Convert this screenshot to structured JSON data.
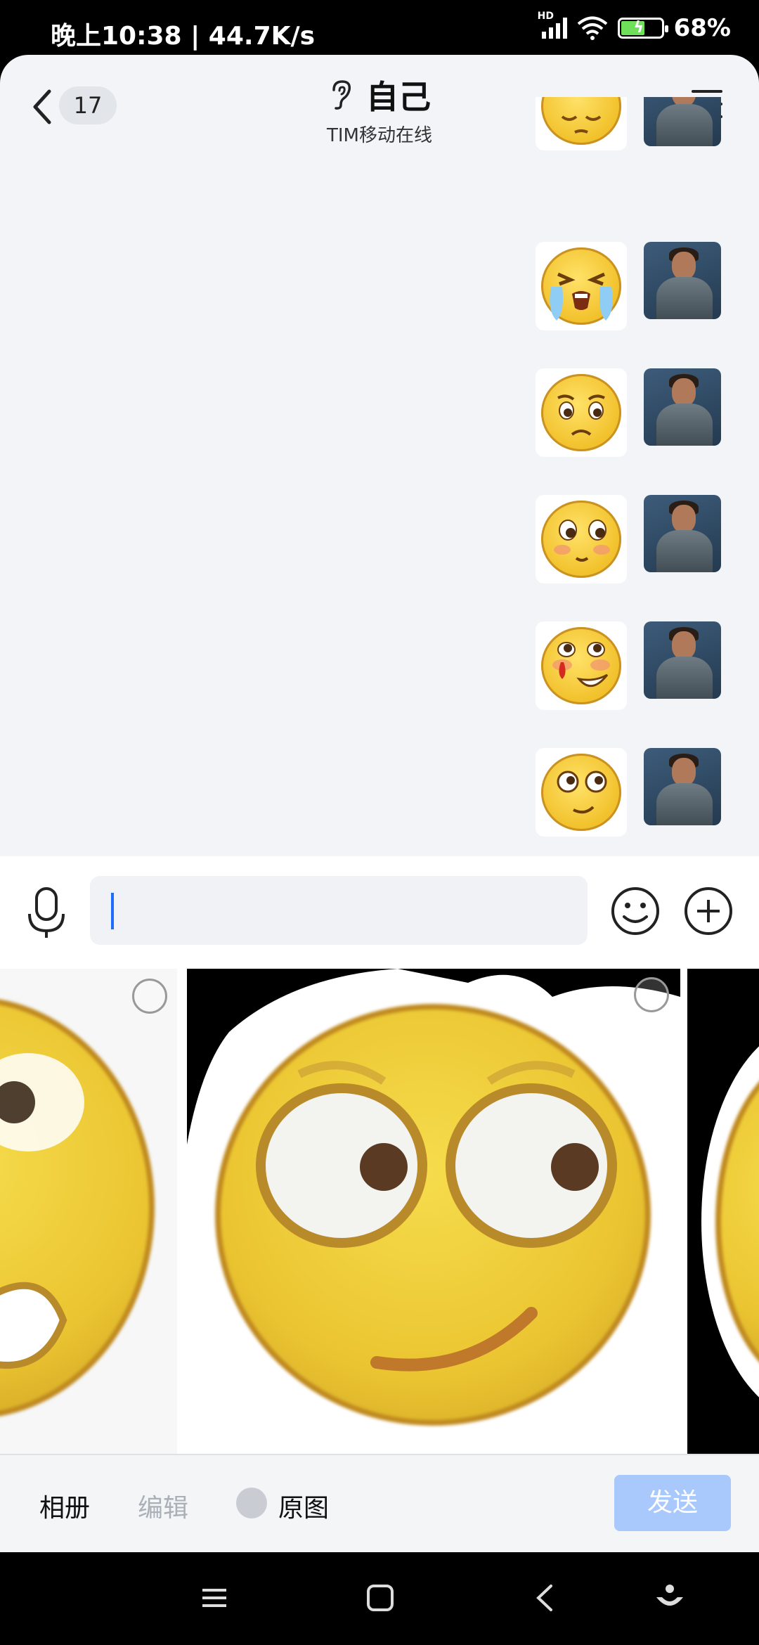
{
  "status_bar": {
    "time": "晚上10:38 | 44.7K/s",
    "network": "HD",
    "battery": "68%"
  },
  "header": {
    "unread_count": "17",
    "title": "自己",
    "subtitle": "TIM移动在线"
  },
  "messages": [
    {
      "type": "sticker",
      "emoji": "sleepy-face"
    },
    {
      "type": "sticker",
      "emoji": "crying-face"
    },
    {
      "type": "sticker",
      "emoji": "worried-face"
    },
    {
      "type": "sticker",
      "emoji": "shy-face"
    },
    {
      "type": "sticker",
      "emoji": "nosebleed-face"
    },
    {
      "type": "sticker",
      "emoji": "smug-face"
    }
  ],
  "input": {
    "value": "",
    "placeholder": ""
  },
  "picker": {
    "album_label": "相册",
    "edit_label": "编辑",
    "original_label": "原图",
    "send_label": "发送",
    "colors": {
      "send_disabled": "#a9c8fb",
      "accent": "#1e6bff"
    }
  }
}
